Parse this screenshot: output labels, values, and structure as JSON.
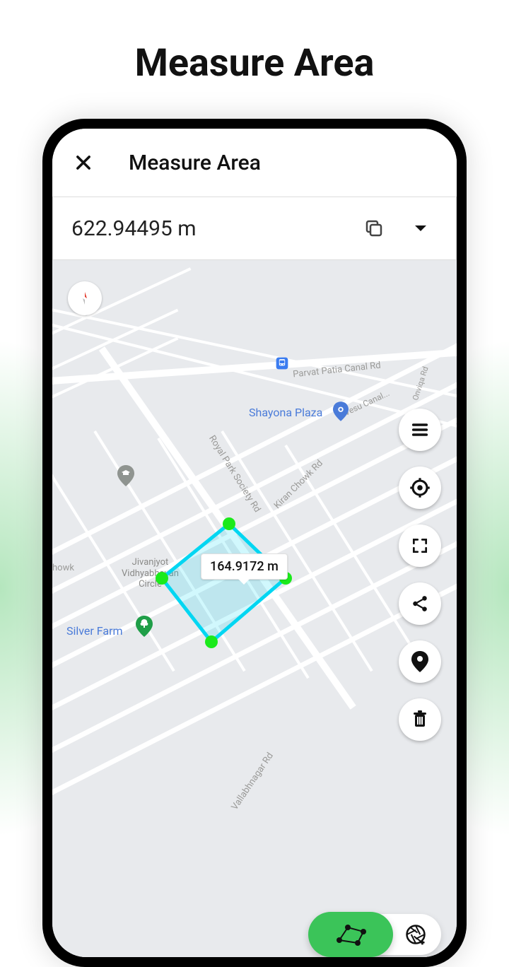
{
  "promo_title": "Measure Area",
  "header": {
    "title": "Measure Area"
  },
  "measurement_bar": {
    "value": "622.94495 m"
  },
  "segment_label": "164.9172 m",
  "map_labels": {
    "shayona_plaza": "Shayona Plaza",
    "silver_farm": "Silver Farm",
    "jivanjyot": "Jivanjyot\nVidhyabhavan\nCircle",
    "canal_rd": "Parvat Patia Canal Rd",
    "vesu_canal": "Vesu Canal...",
    "onviqa": "Onviqa Rd",
    "royal_park": "Royal Park Society Rd",
    "kiran_chowk": "Kiran Chowk Rd",
    "vallabhnagar": "Vallabhnagar Rd",
    "hawai": "howk"
  },
  "side_tools": [
    "menu",
    "locate",
    "fullscreen",
    "share",
    "pin",
    "trash"
  ],
  "colors": {
    "accent": "#3bc459",
    "shape": "#00d6f2"
  }
}
